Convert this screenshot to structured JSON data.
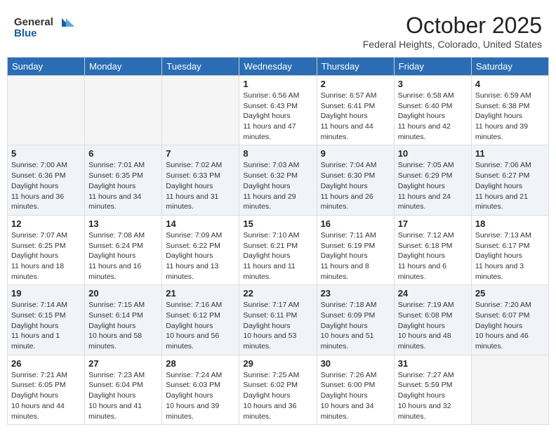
{
  "header": {
    "logo_general": "General",
    "logo_blue": "Blue",
    "month_title": "October 2025",
    "location": "Federal Heights, Colorado, United States"
  },
  "weekdays": [
    "Sunday",
    "Monday",
    "Tuesday",
    "Wednesday",
    "Thursday",
    "Friday",
    "Saturday"
  ],
  "weeks": [
    [
      {
        "day": "",
        "sunrise": "",
        "sunset": "",
        "daylight": ""
      },
      {
        "day": "",
        "sunrise": "",
        "sunset": "",
        "daylight": ""
      },
      {
        "day": "",
        "sunrise": "",
        "sunset": "",
        "daylight": ""
      },
      {
        "day": "1",
        "sunrise": "6:56 AM",
        "sunset": "6:43 PM",
        "daylight": "11 hours and 47 minutes."
      },
      {
        "day": "2",
        "sunrise": "6:57 AM",
        "sunset": "6:41 PM",
        "daylight": "11 hours and 44 minutes."
      },
      {
        "day": "3",
        "sunrise": "6:58 AM",
        "sunset": "6:40 PM",
        "daylight": "11 hours and 42 minutes."
      },
      {
        "day": "4",
        "sunrise": "6:59 AM",
        "sunset": "6:38 PM",
        "daylight": "11 hours and 39 minutes."
      }
    ],
    [
      {
        "day": "5",
        "sunrise": "7:00 AM",
        "sunset": "6:36 PM",
        "daylight": "11 hours and 36 minutes."
      },
      {
        "day": "6",
        "sunrise": "7:01 AM",
        "sunset": "6:35 PM",
        "daylight": "11 hours and 34 minutes."
      },
      {
        "day": "7",
        "sunrise": "7:02 AM",
        "sunset": "6:33 PM",
        "daylight": "11 hours and 31 minutes."
      },
      {
        "day": "8",
        "sunrise": "7:03 AM",
        "sunset": "6:32 PM",
        "daylight": "11 hours and 29 minutes."
      },
      {
        "day": "9",
        "sunrise": "7:04 AM",
        "sunset": "6:30 PM",
        "daylight": "11 hours and 26 minutes."
      },
      {
        "day": "10",
        "sunrise": "7:05 AM",
        "sunset": "6:29 PM",
        "daylight": "11 hours and 24 minutes."
      },
      {
        "day": "11",
        "sunrise": "7:06 AM",
        "sunset": "6:27 PM",
        "daylight": "11 hours and 21 minutes."
      }
    ],
    [
      {
        "day": "12",
        "sunrise": "7:07 AM",
        "sunset": "6:25 PM",
        "daylight": "11 hours and 18 minutes."
      },
      {
        "day": "13",
        "sunrise": "7:08 AM",
        "sunset": "6:24 PM",
        "daylight": "11 hours and 16 minutes."
      },
      {
        "day": "14",
        "sunrise": "7:09 AM",
        "sunset": "6:22 PM",
        "daylight": "11 hours and 13 minutes."
      },
      {
        "day": "15",
        "sunrise": "7:10 AM",
        "sunset": "6:21 PM",
        "daylight": "11 hours and 11 minutes."
      },
      {
        "day": "16",
        "sunrise": "7:11 AM",
        "sunset": "6:19 PM",
        "daylight": "11 hours and 8 minutes."
      },
      {
        "day": "17",
        "sunrise": "7:12 AM",
        "sunset": "6:18 PM",
        "daylight": "11 hours and 6 minutes."
      },
      {
        "day": "18",
        "sunrise": "7:13 AM",
        "sunset": "6:17 PM",
        "daylight": "11 hours and 3 minutes."
      }
    ],
    [
      {
        "day": "19",
        "sunrise": "7:14 AM",
        "sunset": "6:15 PM",
        "daylight": "11 hours and 1 minute."
      },
      {
        "day": "20",
        "sunrise": "7:15 AM",
        "sunset": "6:14 PM",
        "daylight": "10 hours and 58 minutes."
      },
      {
        "day": "21",
        "sunrise": "7:16 AM",
        "sunset": "6:12 PM",
        "daylight": "10 hours and 56 minutes."
      },
      {
        "day": "22",
        "sunrise": "7:17 AM",
        "sunset": "6:11 PM",
        "daylight": "10 hours and 53 minutes."
      },
      {
        "day": "23",
        "sunrise": "7:18 AM",
        "sunset": "6:09 PM",
        "daylight": "10 hours and 51 minutes."
      },
      {
        "day": "24",
        "sunrise": "7:19 AM",
        "sunset": "6:08 PM",
        "daylight": "10 hours and 48 minutes."
      },
      {
        "day": "25",
        "sunrise": "7:20 AM",
        "sunset": "6:07 PM",
        "daylight": "10 hours and 46 minutes."
      }
    ],
    [
      {
        "day": "26",
        "sunrise": "7:21 AM",
        "sunset": "6:05 PM",
        "daylight": "10 hours and 44 minutes."
      },
      {
        "day": "27",
        "sunrise": "7:23 AM",
        "sunset": "6:04 PM",
        "daylight": "10 hours and 41 minutes."
      },
      {
        "day": "28",
        "sunrise": "7:24 AM",
        "sunset": "6:03 PM",
        "daylight": "10 hours and 39 minutes."
      },
      {
        "day": "29",
        "sunrise": "7:25 AM",
        "sunset": "6:02 PM",
        "daylight": "10 hours and 36 minutes."
      },
      {
        "day": "30",
        "sunrise": "7:26 AM",
        "sunset": "6:00 PM",
        "daylight": "10 hours and 34 minutes."
      },
      {
        "day": "31",
        "sunrise": "7:27 AM",
        "sunset": "5:59 PM",
        "daylight": "10 hours and 32 minutes."
      },
      {
        "day": "",
        "sunrise": "",
        "sunset": "",
        "daylight": ""
      }
    ]
  ]
}
